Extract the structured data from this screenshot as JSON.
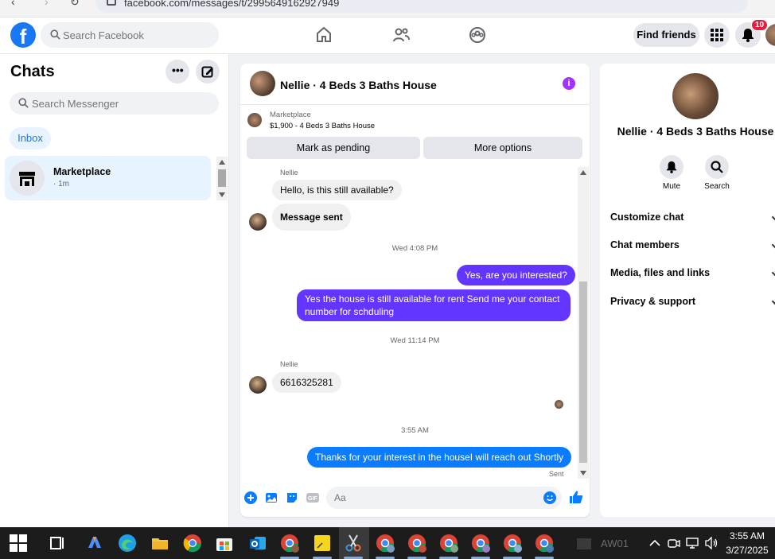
{
  "browser": {
    "url": "facebook.com/messages/t/2995649162927949"
  },
  "topbar": {
    "logo": "f",
    "search_placeholder": "Search Facebook",
    "find_friends": "Find friends",
    "notification_count": "10"
  },
  "chats": {
    "title": "Chats",
    "search_placeholder": "Search Messenger",
    "inbox_tab": "Inbox",
    "conversations": [
      {
        "name": "Marketplace",
        "sub": "· 1m"
      }
    ]
  },
  "conversation": {
    "title": "Nellie · 4 Beds 3 Baths House",
    "marketplace_label": "Marketplace",
    "listing": "$1,900 - 4 Beds 3 Baths House",
    "mark_pending": "Mark as pending",
    "more_options": "More options",
    "messages": {
      "sender1": "Nellie",
      "in1": "Hello, is this still available?",
      "in2": "Message sent",
      "time1": "Wed 4:08 PM",
      "out1": "Yes, are you interested?",
      "out2_line1": "Yes the house is still available for rent Send me your contact",
      "out2_line2": "number for schduling",
      "time2": "Wed 11:14 PM",
      "sender2": "Nellie",
      "in3": "6616325281",
      "time3": "3:55 AM",
      "out3": "Thanks for your interest in the houseI will reach out Shortly",
      "status": "Sent"
    },
    "composer_placeholder": "Aa"
  },
  "details": {
    "name": "Nellie · 4 Beds 3 Baths House",
    "mute": "Mute",
    "search": "Search",
    "rows": [
      "Customize chat",
      "Chat members",
      "Media, files and links",
      "Privacy & support"
    ]
  },
  "taskbar": {
    "time": "3:55 AM",
    "date": "3/27/2025",
    "aw": "AW01"
  },
  "colors": {
    "brand": "#1877f2",
    "outgoing": "#6236ff",
    "outgoing_last": "#0a7cff",
    "info": "#a033ff"
  }
}
